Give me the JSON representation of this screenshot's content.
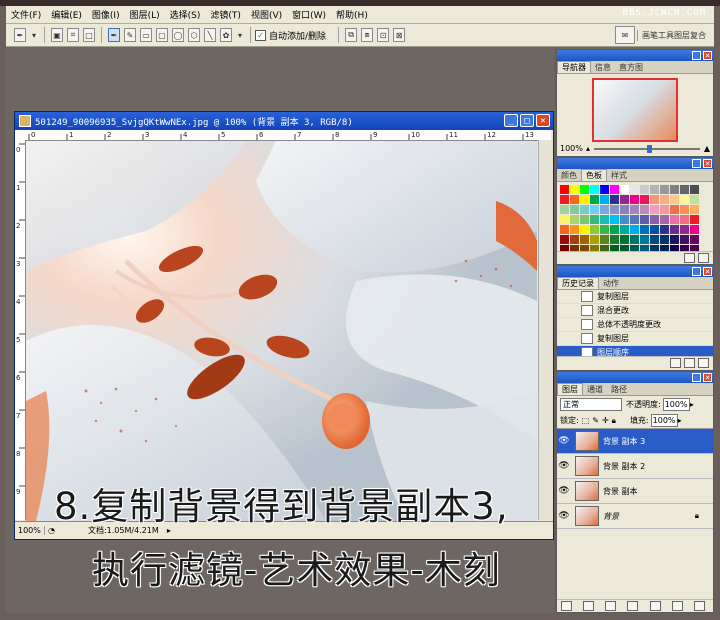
{
  "menubar": {
    "items": [
      "文件(F)",
      "编辑(E)",
      "图像(I)",
      "图层(L)",
      "选择(S)",
      "滤镜(T)",
      "视图(V)",
      "窗口(W)",
      "帮助(H)"
    ],
    "watermark": "BBS.JCWCN.COM"
  },
  "options": {
    "auto_add_label": "自动添加/删除",
    "workspace_label": "画笔工具图层复合"
  },
  "document": {
    "title": "501249_90096935_SvjgQKtWwNEx.jpg @ 100% (背景 副本 3, RGB/8)",
    "zoom": "100%",
    "doc_size": "文档:1.05M/4.21M",
    "ruler_h": [
      "0",
      "1",
      "2",
      "3",
      "4",
      "5",
      "6",
      "7",
      "8",
      "9",
      "10",
      "11",
      "12",
      "13"
    ],
    "ruler_v": [
      "0",
      "1",
      "2",
      "3",
      "4",
      "5",
      "6",
      "7",
      "8",
      "9"
    ]
  },
  "overlay": {
    "line1": "8.复制背景得到背景副本3,",
    "line2": "执行滤镜-艺术效果-木刻"
  },
  "navigator": {
    "tabs": [
      "导航器",
      "信息",
      "直方图"
    ],
    "zoom": "100%"
  },
  "swatches_panel": {
    "tabs": [
      "颜色",
      "色板",
      "样式"
    ],
    "colors": [
      "#ff0000",
      "#ffff00",
      "#00ff00",
      "#00ffff",
      "#0000ff",
      "#ff00ff",
      "#ffffff",
      "#e6e6e6",
      "#cccccc",
      "#b3b3b3",
      "#999999",
      "#808080",
      "#666666",
      "#4d4d4d",
      "#ee1d24",
      "#f26522",
      "#fff200",
      "#00a651",
      "#00aeef",
      "#2e3192",
      "#92278f",
      "#ec008c",
      "#ed145b",
      "#f7977a",
      "#fbad82",
      "#fdc68c",
      "#fff79a",
      "#c4df9b",
      "#a3d39c",
      "#82ca9c",
      "#7accc8",
      "#6dcff6",
      "#7da7d9",
      "#8393ca",
      "#8781bd",
      "#a186be",
      "#bd8cbf",
      "#f49ac1",
      "#f5989d",
      "#f26c4f",
      "#f68e55",
      "#fbaf5c",
      "#fff467",
      "#acd372",
      "#7dc473",
      "#3cb878",
      "#1cbbb4",
      "#00bff3",
      "#448ccb",
      "#5674b9",
      "#605ca8",
      "#855fa8",
      "#a864a8",
      "#f06eaa",
      "#f26d7d",
      "#ed1c24",
      "#f26522",
      "#f7941d",
      "#fff200",
      "#8dc63f",
      "#39b54a",
      "#00a651",
      "#00a99d",
      "#00aeef",
      "#0072bc",
      "#0054a6",
      "#2e3192",
      "#662d91",
      "#92278f",
      "#ec008c",
      "#9e0b0f",
      "#a0410d",
      "#a36209",
      "#aba000",
      "#598527",
      "#197b30",
      "#007236",
      "#00746b",
      "#0076a3",
      "#004a80",
      "#003471",
      "#1b1464",
      "#440e62",
      "#630460",
      "#790000",
      "#7b2e00",
      "#7d4900",
      "#827b00",
      "#406618",
      "#005e20",
      "#005826",
      "#005952",
      "#005b7f",
      "#003663",
      "#002157",
      "#0d004c",
      "#32004b",
      "#4b0049",
      "#c7b299",
      "#998675",
      "#736357",
      "#534741",
      "#37302d",
      "#c69c6d",
      "#a67c52",
      "#8c6239",
      "#754c24",
      "#603913",
      "#ffffff",
      "#000000",
      "#e8d7b8",
      "#c8a878"
    ]
  },
  "history": {
    "tabs": [
      "历史记录",
      "动作"
    ],
    "items": [
      "复制图层",
      "混合更改",
      "总体不透明度更改",
      "复制图层",
      "图层顺序"
    ]
  },
  "layers": {
    "tabs": [
      "图层",
      "通道",
      "路径"
    ],
    "blend_mode": "正常",
    "opacity_label": "不透明度:",
    "opacity": "100%",
    "lock_label": "锁定:",
    "fill_label": "填充:",
    "fill": "100%",
    "items": [
      "背景 副本 3",
      "背景 副本 2",
      "背景 副本",
      "背景"
    ]
  }
}
